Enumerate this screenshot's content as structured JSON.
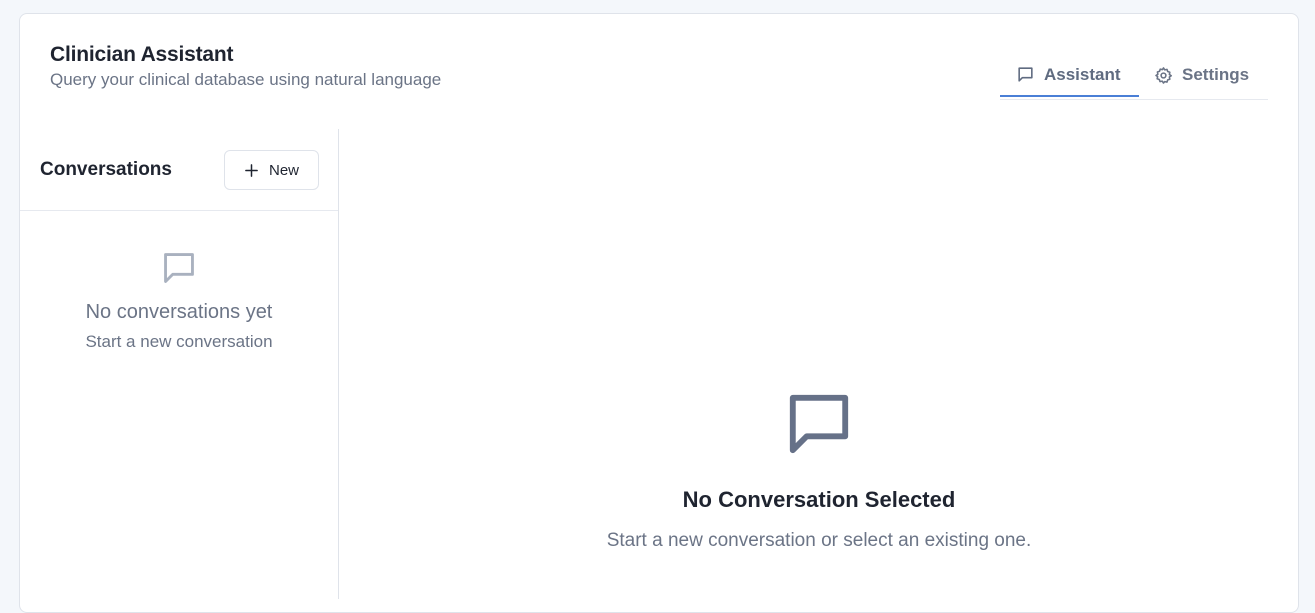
{
  "header": {
    "title": "Clinician Assistant",
    "subtitle": "Query your clinical database using natural language"
  },
  "tabs": [
    {
      "label": "Assistant",
      "icon": "message-square-icon",
      "active": true
    },
    {
      "label": "Settings",
      "icon": "gear-icon",
      "active": false
    }
  ],
  "sidebar": {
    "title": "Conversations",
    "new_button_label": "New",
    "empty_title": "No conversations yet",
    "empty_subtitle": "Start a new conversation"
  },
  "main": {
    "empty_title": "No Conversation Selected",
    "empty_subtitle": "Start a new conversation or select an existing one."
  },
  "colors": {
    "accent": "#4a7fd6",
    "muted_text": "#6b7486",
    "border": "#dfe3ea",
    "icon_gray": "#a9b1bf",
    "icon_dark": "#667188"
  }
}
